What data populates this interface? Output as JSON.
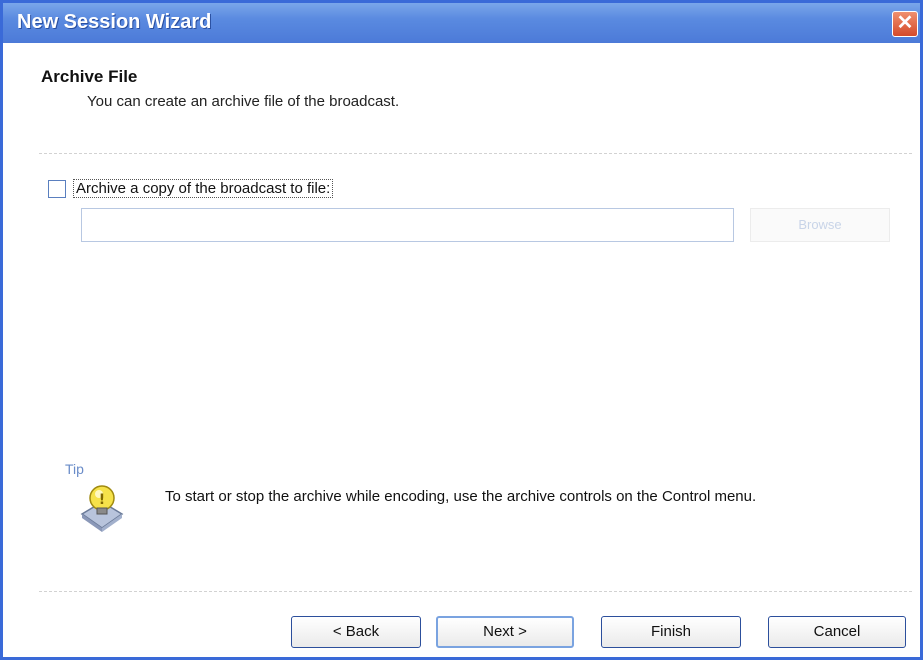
{
  "window": {
    "title": "New Session Wizard",
    "close_symbol": "✕"
  },
  "header": {
    "title": "Archive File",
    "subtitle": "You can create an archive file of the broadcast."
  },
  "archive": {
    "checkbox_checked": false,
    "checkbox_label": "Archive a copy of the broadcast to file:",
    "path_value": "",
    "browse_label": "Browse"
  },
  "tip": {
    "label": "Tip",
    "icon": "tip-lightbulb-icon",
    "text": "To start or stop the archive while encoding, use the archive controls on the Control menu."
  },
  "buttons": {
    "back": "< Back",
    "next": "Next >",
    "finish": "Finish",
    "cancel": "Cancel"
  },
  "colors": {
    "titlebar": "#5a8ae0",
    "close": "#d44a2a",
    "tip_label": "#6a8cc8"
  }
}
